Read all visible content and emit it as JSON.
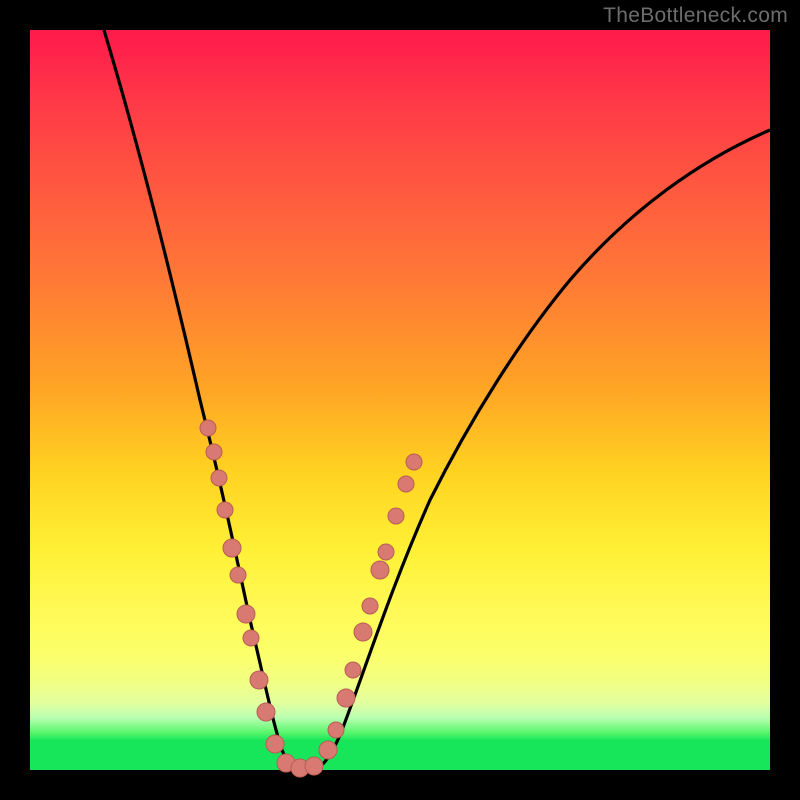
{
  "watermark": "TheBottleneck.com",
  "colors": {
    "frame": "#000000",
    "gradient_top": "#ff1a4c",
    "gradient_mid": "#ffd321",
    "gradient_bottom": "#18e65a",
    "curve": "#000000",
    "marker_fill": "#d87a72",
    "marker_stroke": "#b85c55"
  },
  "chart_data": {
    "type": "line",
    "title": "",
    "xlabel": "",
    "ylabel": "",
    "xlim": [
      0,
      100
    ],
    "ylim": [
      0,
      100
    ],
    "series": [
      {
        "name": "bottleneck-curve",
        "x": [
          10,
          12,
          15,
          18,
          20,
          22,
          25,
          27,
          29,
          30,
          32,
          34,
          36,
          38,
          40,
          45,
          50,
          55,
          60,
          65,
          70,
          75,
          80,
          85,
          90,
          95,
          100
        ],
        "y": [
          100,
          91,
          80,
          68,
          60,
          52,
          40,
          30,
          20,
          12,
          4,
          0,
          0,
          4,
          12,
          28,
          40,
          47,
          53,
          59,
          64,
          69,
          73,
          77,
          80,
          83,
          86
        ]
      }
    ],
    "markers": [
      {
        "series": "left-branch",
        "x": [
          23.0,
          24.0,
          24.5,
          25.5,
          27.0,
          27.5,
          28.5,
          29.0,
          30.0,
          31.0,
          32.5,
          34.0,
          36.0
        ],
        "y": [
          48,
          44,
          41,
          36,
          30,
          27,
          22,
          18,
          12,
          6,
          2,
          0,
          0
        ]
      },
      {
        "series": "right-branch",
        "x": [
          38.0,
          39.0,
          40.5,
          41.5,
          43.0,
          44.0,
          45.5,
          46.5,
          48.0,
          49.5
        ],
        "y": [
          5,
          10,
          18,
          23,
          29,
          33,
          37,
          40,
          43,
          47
        ]
      }
    ],
    "annotations": []
  }
}
